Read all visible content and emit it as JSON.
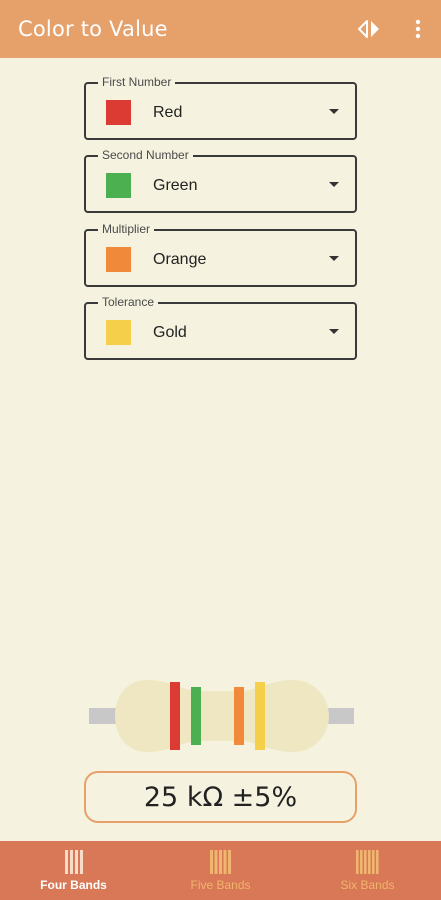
{
  "appbar": {
    "title": "Color to Value",
    "swap_icon": "swap-horizontal-icon",
    "menu_icon": "more-vert-icon"
  },
  "fields": [
    {
      "label": "First Number",
      "value": "Red",
      "color": "#dc3b34"
    },
    {
      "label": "Second Number",
      "value": "Green",
      "color": "#4caf50"
    },
    {
      "label": "Multiplier",
      "value": "Orange",
      "color": "#f08a3a"
    },
    {
      "label": "Tolerance",
      "value": "Gold",
      "color": "#f6cf4a"
    }
  ],
  "resistor": {
    "body_color": "#efe6c2",
    "lead_color": "#c8c8c8",
    "bands": [
      "#dc3b34",
      "#4caf50",
      "#f08a3a",
      "#f6cf4a"
    ]
  },
  "result": {
    "text": "25 kΩ ±5%"
  },
  "bottom_nav": {
    "items": [
      {
        "label": "Four Bands",
        "icon": "four-bands-icon",
        "active": true
      },
      {
        "label": "Five Bands",
        "icon": "five-bands-icon",
        "active": false
      },
      {
        "label": "Six Bands",
        "icon": "six-bands-icon",
        "active": false
      }
    ]
  },
  "colors": {
    "accent": "#e6a06a",
    "nav_background": "#d97856",
    "background": "#f5f3e0"
  }
}
